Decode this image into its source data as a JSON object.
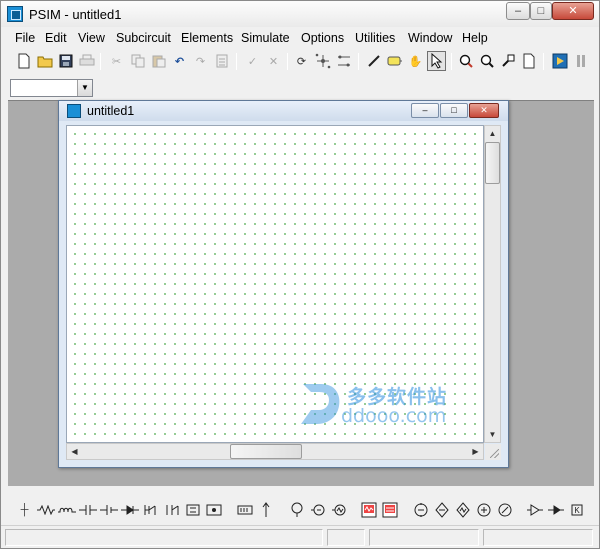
{
  "window": {
    "title": "PSIM - untitled1"
  },
  "menu": [
    "File",
    "Edit",
    "View",
    "Subcircuit",
    "Elements",
    "Simulate",
    "Options",
    "Utilities",
    "Window",
    "Help"
  ],
  "toolbar": {
    "icons": [
      "new-file",
      "open-folder",
      "save",
      "print",
      "cut",
      "copy",
      "paste",
      "undo",
      "redo",
      "clipboard",
      "checkmark",
      "cross",
      "rotate",
      "node-grid-a",
      "node-grid-b",
      "wire-pencil",
      "label-tag",
      "hand-pan",
      "select-arrow",
      "zoom-in",
      "zoom-out",
      "zoom-fit",
      "page",
      "run-simulation",
      "pause"
    ]
  },
  "combo": {
    "value": ""
  },
  "document": {
    "title": "untitled1"
  },
  "watermark": {
    "brand": "多多软件站",
    "url": "ddooo.com"
  },
  "elements_toolbar": {
    "icons": [
      "ground",
      "resistor",
      "inductor",
      "capacitor",
      "battery",
      "diode-stack",
      "switch",
      "transformer-a",
      "transformer-b",
      "coupled-coils",
      "block-element",
      "arrow-element",
      "voltage-probe",
      "current-probe",
      "scope",
      "ac-source",
      "dc-source",
      "square-wave",
      "meter-a",
      "meter-b",
      "meter-c",
      "meter-d",
      "meter-e",
      "comparator",
      "logic-gate",
      "k-block"
    ]
  },
  "colors": {
    "grid_dot": "#7cbf7c",
    "mdi_bg": "#ababab",
    "close_red": "#c7493a"
  }
}
